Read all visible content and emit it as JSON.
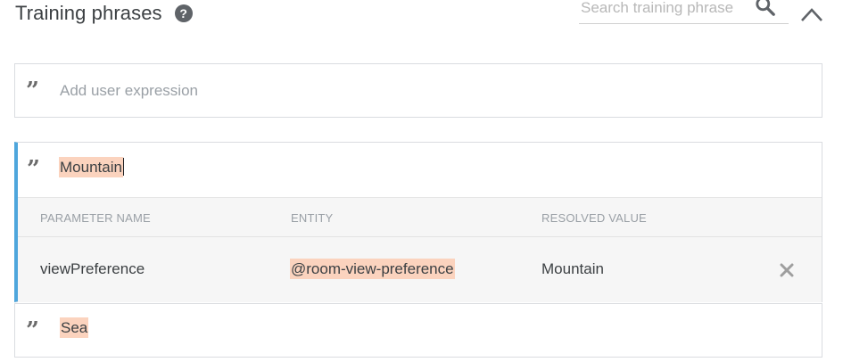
{
  "header": {
    "title": "Training phrases",
    "help_icon": "help-circle-icon",
    "search_placeholder": "Search training phrase",
    "search_value": ""
  },
  "add_expression": {
    "placeholder": "Add user expression",
    "value": ""
  },
  "phrases": [
    {
      "text": "Mountain",
      "selected": true,
      "parameters": {
        "headers": [
          "PARAMETER NAME",
          "ENTITY",
          "RESOLVED VALUE"
        ],
        "rows": [
          {
            "name": "viewPreference",
            "entity": "@room-view-preference",
            "resolved": "Mountain"
          }
        ]
      }
    },
    {
      "text": "Sea",
      "selected": false
    }
  ],
  "colors": {
    "accent_bar": "#4ea6dc",
    "annotation_highlight": "#fbd3be",
    "table_bg": "#f6f6f6"
  }
}
